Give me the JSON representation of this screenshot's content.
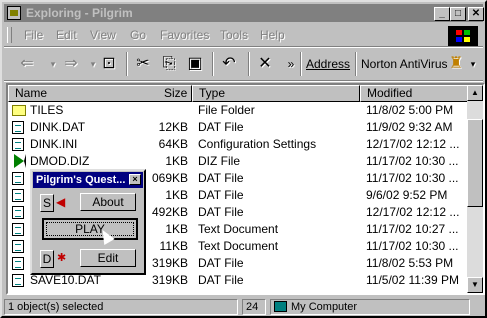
{
  "window": {
    "title": "Exploring - Pilgrim",
    "controls": {
      "minimize": "_",
      "maximize": "□",
      "close": "✕"
    }
  },
  "menu": [
    "File",
    "Edit",
    "View",
    "Go",
    "Favorites",
    "Tools",
    "Help"
  ],
  "toolbar": {
    "address_label": "Address",
    "norton_label": "Norton AntiVirus",
    "more": "»"
  },
  "columns": [
    "Name",
    "Size",
    "Type",
    "Modified"
  ],
  "files": [
    {
      "name": "TILES",
      "size": "",
      "type": "File Folder",
      "modified": "11/8/02 5:00 PM",
      "icon": "folder"
    },
    {
      "name": "DINK.DAT",
      "size": "12KB",
      "type": "DAT File",
      "modified": "11/9/02 9:32 AM",
      "icon": "doc"
    },
    {
      "name": "DINK.INI",
      "size": "64KB",
      "type": "Configuration Settings",
      "modified": "12/17/02 12:12 ...",
      "icon": "doc"
    },
    {
      "name": "DMOD.DIZ",
      "size": "1KB",
      "type": "DIZ File",
      "modified": "11/17/02 10:30 ...",
      "icon": "play"
    },
    {
      "name": "",
      "size": "069KB",
      "type": "DAT File",
      "modified": "11/17/02 10:30 ...",
      "icon": "doc"
    },
    {
      "name": "",
      "size": "1KB",
      "type": "DAT File",
      "modified": "9/6/02 9:52 PM",
      "icon": "doc"
    },
    {
      "name": "",
      "size": "492KB",
      "type": "DAT File",
      "modified": "12/17/02 12:12 ...",
      "icon": "doc"
    },
    {
      "name": "",
      "size": "1KB",
      "type": "Text Document",
      "modified": "11/17/02 10:27 ...",
      "icon": "doc"
    },
    {
      "name": "",
      "size": "11KB",
      "type": "Text Document",
      "modified": "11/17/02 10:30 ...",
      "icon": "doc"
    },
    {
      "name": "",
      "size": "319KB",
      "type": "DAT File",
      "modified": "11/8/02 5:53 PM",
      "icon": "doc"
    },
    {
      "name": "SAVE10.DAT",
      "size": "319KB",
      "type": "DAT File",
      "modified": "11/5/02 11:39 PM",
      "icon": "doc"
    }
  ],
  "status": {
    "selected": "1 object(s) selected",
    "size": "24",
    "location": "My Computer"
  },
  "popup": {
    "title": "Pilgrim's Quest...",
    "close": "×",
    "s_label": "S",
    "d_label": "D",
    "about_label": "About",
    "play_label": "PLAY",
    "edit_label": "Edit"
  }
}
